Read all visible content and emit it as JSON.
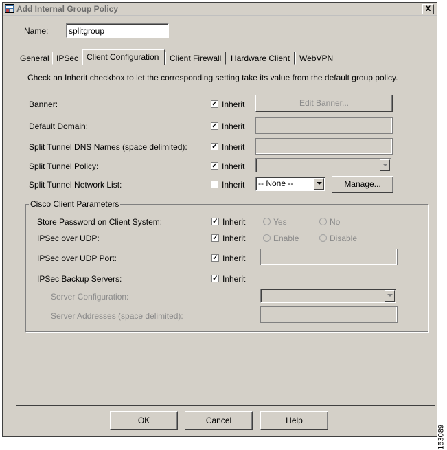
{
  "window": {
    "title": "Add Internal Group Policy",
    "close_label": "X"
  },
  "name_field": {
    "label": "Name:",
    "value": "splitgroup"
  },
  "tabs": [
    {
      "label": "General"
    },
    {
      "label": "IPSec"
    },
    {
      "label": "Client Configuration"
    },
    {
      "label": "Client Firewall"
    },
    {
      "label": "Hardware Client"
    },
    {
      "label": "WebVPN"
    }
  ],
  "panel": {
    "instructions": "Check an Inherit checkbox to let the corresponding setting take its value from the default group policy.",
    "rows": {
      "banner": {
        "label": "Banner:",
        "inherit": "Inherit",
        "button": "Edit Banner..."
      },
      "default_domain": {
        "label": "Default Domain:",
        "inherit": "Inherit"
      },
      "split_dns": {
        "label": "Split Tunnel DNS Names (space delimited):",
        "inherit": "Inherit"
      },
      "split_policy": {
        "label": "Split Tunnel Policy:",
        "inherit": "Inherit"
      },
      "split_list": {
        "label": "Split Tunnel Network List:",
        "inherit": "Inherit",
        "selected": "-- None --",
        "button": "Manage..."
      }
    },
    "group": {
      "title": "Cisco Client Parameters",
      "store_password": {
        "label": "Store Password on Client System:",
        "inherit": "Inherit",
        "opt1": "Yes",
        "opt2": "No"
      },
      "ipsec_udp": {
        "label": "IPSec over UDP:",
        "inherit": "Inherit",
        "opt1": "Enable",
        "opt2": "Disable"
      },
      "ipsec_udp_port": {
        "label": "IPSec over UDP Port:",
        "inherit": "Inherit"
      },
      "backup_servers": {
        "label": "IPSec Backup Servers:",
        "inherit": "Inherit"
      },
      "server_config": {
        "label": "Server Configuration:"
      },
      "server_addresses": {
        "label": "Server Addresses (space delimited):"
      }
    }
  },
  "footer": {
    "ok": "OK",
    "cancel": "Cancel",
    "help": "Help"
  },
  "side_code": "153089"
}
